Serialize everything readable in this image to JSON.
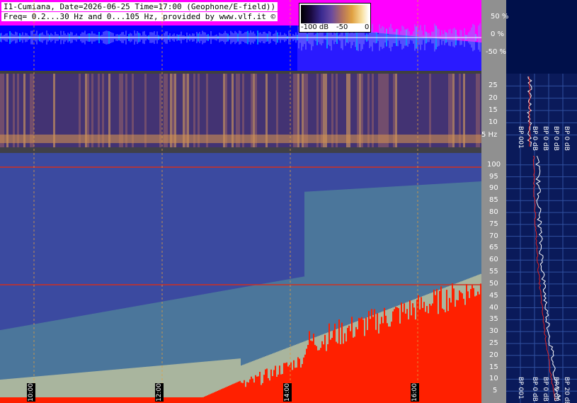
{
  "header": {
    "line1": "I1-Cumiana, Date=2026-06-25 Time=17:00 (Geophone/E-field))",
    "line2": "Freq= 0.2...30 Hz and 0...105 Hz, provided by www.vlf.it ©"
  },
  "colorbar": {
    "labels": [
      "-100 dB",
      "-50",
      "0"
    ]
  },
  "colors": {
    "waveform_bg": "#ff00ff",
    "waveform_band": "#0000ff",
    "spectrogram_low": "#3b4aa0",
    "spectrogram_mid": "#6ab090",
    "spectrogram_high": "#f0e090",
    "saturation": "#ff2000",
    "marker_line": "#d03020"
  },
  "chart_data": [
    {
      "type": "line",
      "panel": "waveform",
      "y_tick_labels": [
        "50 %",
        "0 %",
        "-50 %"
      ],
      "y_ticks": [
        50,
        0,
        -50
      ]
    },
    {
      "type": "heatmap",
      "panel": "low-frequency",
      "xlabel": "",
      "ylabel": "Hz",
      "y_tick_labels": [
        "25",
        "20",
        "15",
        "10",
        "5 Hz"
      ],
      "y_ticks": [
        25,
        20,
        15,
        10,
        5
      ],
      "ylim": [
        0,
        30
      ]
    },
    {
      "type": "heatmap",
      "panel": "high-frequency",
      "x_tick_labels": [
        "10:00",
        "12:00",
        "14:00",
        "16:00"
      ],
      "y_tick_labels": [
        "100",
        "95",
        "90",
        "85",
        "80",
        "75",
        "70",
        "65",
        "60",
        "55",
        "50",
        "45",
        "40",
        "35",
        "30",
        "25",
        "20",
        "15",
        "10",
        "5"
      ],
      "y_ticks": [
        100,
        95,
        90,
        85,
        80,
        75,
        70,
        65,
        60,
        55,
        50,
        45,
        40,
        35,
        30,
        25,
        20,
        15,
        10,
        5
      ],
      "ylim": [
        0,
        105
      ]
    },
    {
      "type": "line",
      "panel": "profile",
      "labels_low": [
        "BP 001",
        "BP 0 dB",
        "BP 0 dB",
        "BP 0 dB",
        "BP 0 dB"
      ],
      "labels_high": [
        "BP 001",
        "BP 0 dB",
        "BP 0 dB",
        "BP 0 dB",
        "BP 20 dB"
      ]
    }
  ]
}
